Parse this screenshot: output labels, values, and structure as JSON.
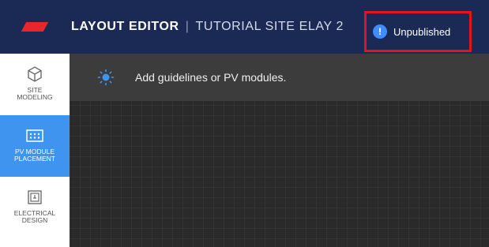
{
  "header": {
    "app_title": "LAYOUT EDITOR",
    "separator": "|",
    "site_name": "TUTORIAL SITE ELAY 2",
    "status_label": "Unpublished",
    "status_icon": "exclamation-icon",
    "logo_color": "#e8262b",
    "bar_color": "#1b2a55",
    "highlight_color": "#e3141b"
  },
  "sidebar": {
    "items": [
      {
        "label_line1": "SITE",
        "label_line2": "MODELING",
        "icon": "cube-icon",
        "active": false
      },
      {
        "label_line1": "PV MODULE",
        "label_line2": "PLACEMENT",
        "icon": "module-grid-icon",
        "active": true
      },
      {
        "label_line1": "ELECTRICAL",
        "label_line2": "DESIGN",
        "icon": "electrical-icon",
        "active": false
      }
    ],
    "active_color": "#3f94f0"
  },
  "banner": {
    "icon": "sun-icon",
    "message": "Add guidelines or PV modules."
  }
}
